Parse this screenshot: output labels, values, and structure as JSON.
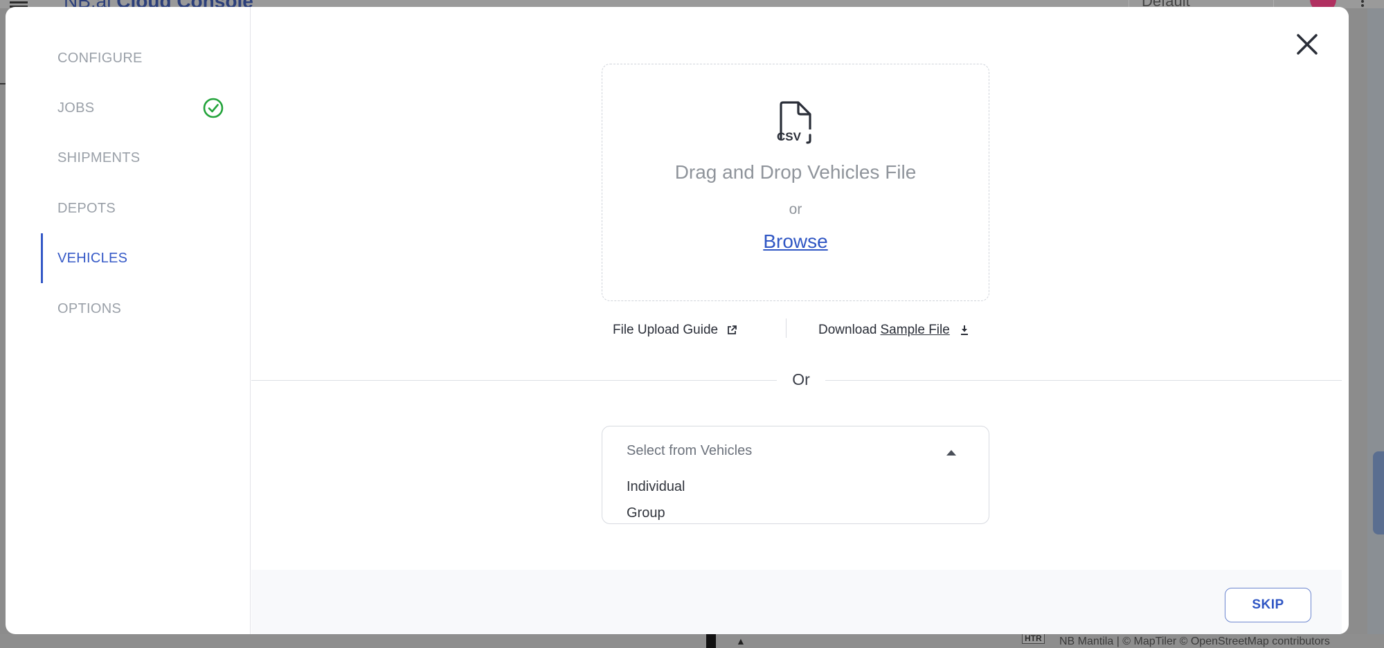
{
  "background": {
    "brand_prefix": "NB.ai",
    "brand_name": "Cloud Console",
    "project_select": "Default",
    "map_attribution": "NB Mantila | © MapTiler © OpenStreetMap contributors",
    "htr_label": "HTR"
  },
  "sidebar": {
    "items": [
      {
        "label": "CONFIGURE",
        "completed": false,
        "active": false
      },
      {
        "label": "JOBS",
        "completed": true,
        "active": false
      },
      {
        "label": "SHIPMENTS",
        "completed": false,
        "active": false
      },
      {
        "label": "DEPOTS",
        "completed": false,
        "active": false
      },
      {
        "label": "VEHICLES",
        "completed": false,
        "active": true
      },
      {
        "label": "OPTIONS",
        "completed": false,
        "active": false
      }
    ]
  },
  "upload": {
    "icon": "csv-file-icon",
    "icon_text": "CSV",
    "title": "Drag and Drop Vehicles File",
    "or_text": "or",
    "browse_label": "Browse"
  },
  "links": {
    "guide_label": "File Upload Guide",
    "download_prefix": "Download",
    "download_link": "Sample File"
  },
  "divider_label": "Or",
  "vehicle_select": {
    "placeholder": "Select from Vehicles",
    "options": [
      "Individual",
      "Group"
    ]
  },
  "footer": {
    "skip_label": "SKIP"
  },
  "colors": {
    "accent": "#3559c7",
    "check_green": "#22a33a",
    "muted_text": "#9aa0a8"
  }
}
